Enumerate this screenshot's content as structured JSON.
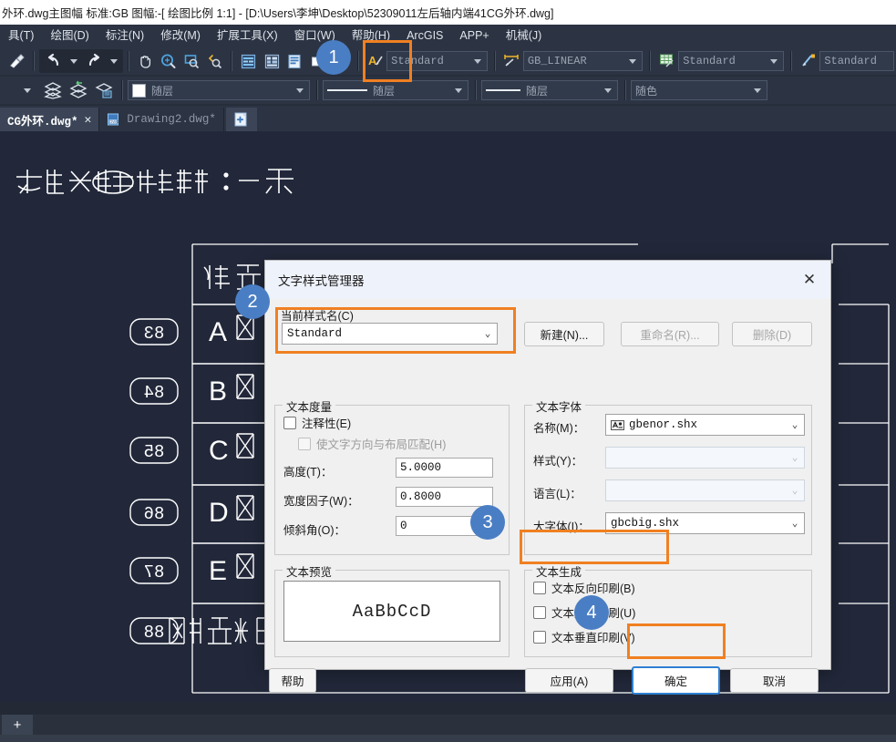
{
  "window": {
    "title": "外环.dwg主图幅 标准:GB 图幅:-[ 绘图比例 1:1] - [D:\\Users\\李坤\\Desktop\\52309011左后轴内端41CG外环.dwg]"
  },
  "menu": {
    "items": [
      {
        "label": "具(T)"
      },
      {
        "label": "绘图(D)"
      },
      {
        "label": "标注(N)"
      },
      {
        "label": "修改(M)"
      },
      {
        "label": "扩展工具(X)"
      },
      {
        "label": "窗口(W)"
      },
      {
        "label": "帮助(H)"
      },
      {
        "label": "ArcGIS"
      },
      {
        "label": "APP+"
      },
      {
        "label": "机械(J)"
      }
    ]
  },
  "toolbar_row1": {
    "combos": [
      {
        "name": "text-style-combo",
        "value": "Standard"
      },
      {
        "name": "dimension-style-combo",
        "value": "GB_LINEAR"
      },
      {
        "name": "table-style-combo",
        "value": "Standard"
      },
      {
        "name": "multileader-style-combo",
        "value": "Standard"
      }
    ]
  },
  "toolbar_row2": {
    "combos": [
      {
        "name": "layer-combo",
        "value": "随层"
      },
      {
        "name": "color-combo",
        "value": "随层"
      },
      {
        "name": "linetype-combo",
        "value": "随层"
      },
      {
        "name": "lineweight-combo",
        "value": "随色"
      }
    ]
  },
  "doc_tabs": [
    {
      "label": "CG外环.dwg*",
      "active": true,
      "close": "✕"
    },
    {
      "label": "Drawing2.dwg*",
      "active": false
    }
  ],
  "new_tab_label": "+",
  "layout_add_label": "+",
  "canvas": {
    "title_text_mirrored": "蔬账汉转远教惜杯 :一表",
    "cell_label_mirrored": "滑套柄",
    "rows": [
      {
        "num": "83",
        "letter": "A",
        "mark": "区"
      },
      {
        "num": "84",
        "letter": "B",
        "mark": "区"
      },
      {
        "num": "85",
        "letter": "C",
        "mark": "区"
      },
      {
        "num": "86",
        "letter": "D",
        "mark": "区"
      },
      {
        "num": "87",
        "letter": "E",
        "mark": "区"
      },
      {
        "num": "88",
        "letter": "",
        "mark": "对制更祭号现"
      }
    ]
  },
  "dialog": {
    "title": "文字样式管理器",
    "close_glyph": "✕",
    "current_style": {
      "legend": "当前样式名(C)",
      "value": "Standard",
      "buttons": [
        {
          "label": "新建(N)...",
          "name": "new-style-button",
          "disabled": false
        },
        {
          "label": "重命名(R)...",
          "name": "rename-style-button",
          "disabled": true
        },
        {
          "label": "删除(D)",
          "name": "delete-style-button",
          "disabled": true
        }
      ]
    },
    "text_measure": {
      "legend": "文本度量",
      "annotative_label": "注释性(E)",
      "match_orientation_label": "使文字方向与布局匹配(H)",
      "height_label": "高度(T)：",
      "height_value": "5.0000",
      "width_factor_label": "宽度因子(W)：",
      "width_factor_value": "0.8000",
      "oblique_label": "倾斜角(O)：",
      "oblique_value": "0"
    },
    "text_font": {
      "legend": "文本字体",
      "name_label": "名称(M)：",
      "name_value": "gbenor.shx",
      "style_label": "样式(Y)：",
      "style_value": "",
      "language_label": "语言(L)：",
      "language_value": "",
      "bigfont_label": "大字体(I)：",
      "bigfont_value": "gbcbig.shx"
    },
    "preview": {
      "legend": "文本预览",
      "sample": "AaBbCcD"
    },
    "text_generation": {
      "legend": "文本生成",
      "backwards_label": "文本反向印刷(B)",
      "upsidedown_label": "文本颠倒印刷(U)",
      "vertical_label": "文本垂直印刷(V)"
    },
    "footer": {
      "help": "帮助",
      "apply": "应用(A)",
      "ok": "确定",
      "cancel": "取消"
    }
  },
  "annotations": {
    "badges": [
      {
        "label": "1"
      },
      {
        "label": "2"
      },
      {
        "label": "3"
      },
      {
        "label": "4"
      }
    ],
    "highlight_color": "#f08021",
    "badge_color": "#4a7ec4"
  }
}
